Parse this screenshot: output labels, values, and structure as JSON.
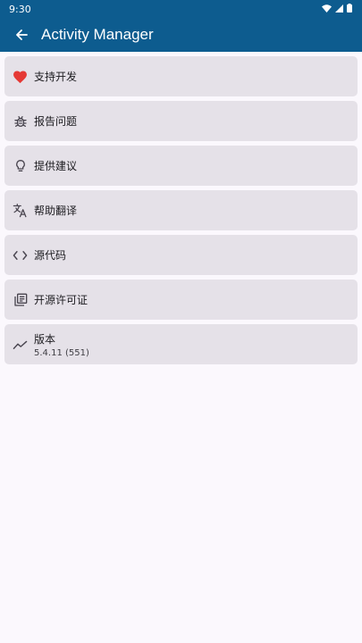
{
  "status_bar": {
    "time": "9:30"
  },
  "app_bar": {
    "title": "Activity Manager"
  },
  "items": [
    {
      "label": "支持开发",
      "icon": "heart-icon"
    },
    {
      "label": "报告问题",
      "icon": "bug-icon"
    },
    {
      "label": "提供建议",
      "icon": "lightbulb-icon"
    },
    {
      "label": "帮助翻译",
      "icon": "translate-icon"
    },
    {
      "label": "源代码",
      "icon": "code-icon"
    },
    {
      "label": "开源许可证",
      "icon": "library-icon"
    },
    {
      "label": "版本",
      "sub": "5.4.11 (551)",
      "icon": "trending-icon"
    }
  ],
  "colors": {
    "primary": "#0d5c8f",
    "card": "#e5e1e8",
    "heart": "#e53935",
    "background": "#fbf8fd"
  }
}
